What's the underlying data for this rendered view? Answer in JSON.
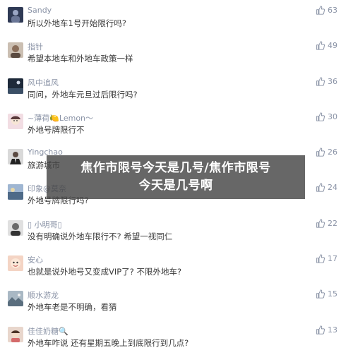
{
  "comments": [
    {
      "user": "Sandy",
      "text": "所以外地车1号开始限行吗?",
      "likes": "63",
      "avatar_icon": "avatar-dark-figure",
      "avatar_color": "#2f3a55"
    },
    {
      "user": "指针",
      "text": "希望本地车和外地车政策一样",
      "likes": "49",
      "avatar_icon": "avatar-person-photo",
      "avatar_color": "#9b8a7a"
    },
    {
      "user": "风中追风",
      "text": "同问，外地车元旦过后限行吗?",
      "likes": "36",
      "avatar_icon": "avatar-night-scene",
      "avatar_color": "#1e2a3a"
    },
    {
      "user": "~薄荷🍋Lemon～",
      "text": "外地号牌限行不",
      "likes": "30",
      "avatar_icon": "avatar-girl-illustration",
      "avatar_color": "#e8c8d0"
    },
    {
      "user": "Yingchao",
      "text": "旅游城市",
      "likes": "26",
      "avatar_icon": "avatar-man-suit",
      "avatar_color": "#3a3a3a"
    },
    {
      "user": "印象@莫奈",
      "text": "外地号牌限行吗?",
      "likes": "24",
      "avatar_icon": "avatar-painting",
      "avatar_color": "#6e86a8"
    },
    {
      "user": "▯ 小明哥▯",
      "text": "没有明确说外地车限行不? 希望一视同仁",
      "likes": "22",
      "avatar_icon": "avatar-man-portrait",
      "avatar_color": "#555555"
    },
    {
      "user": "安心",
      "text": "也就是说外地号又变成VIP了? 不限外地车?",
      "likes": "17",
      "avatar_icon": "avatar-cartoon",
      "avatar_color": "#e8b8a8"
    },
    {
      "user": "顺水游龙",
      "text": "外地车老是不明确，看猜",
      "likes": "15",
      "avatar_icon": "avatar-landscape",
      "avatar_color": "#7a8a96"
    },
    {
      "user": "佳佳奶糖🔍",
      "text": "外地车咋说 还有星期五晚上到底限行到几点?",
      "likes": "13",
      "avatar_icon": "avatar-child-photo",
      "avatar_color": "#c8a898"
    }
  ],
  "banner": {
    "line1": "焦作市限号今天是几号/焦作市限号",
    "line2": "今天是几号啊"
  }
}
